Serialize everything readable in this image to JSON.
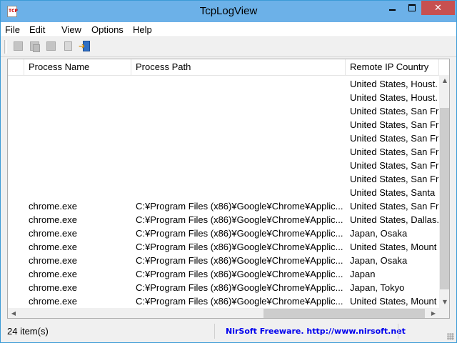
{
  "window": {
    "title": "TcpLogView"
  },
  "titlebar_buttons": {
    "close": "✕"
  },
  "menu": [
    "File",
    "Edit",
    "View",
    "Options",
    "Help"
  ],
  "toolbar": {
    "buttons": [
      "save-icon",
      "copy-icon",
      "properties-icon",
      "report-icon",
      "exit-icon"
    ]
  },
  "columns": [
    "Process Name",
    "Process Path",
    "Remote IP Country"
  ],
  "rows": [
    {
      "process_name": "",
      "process_path": "",
      "country": "United States, Houst."
    },
    {
      "process_name": "",
      "process_path": "",
      "country": "United States, Houst."
    },
    {
      "process_name": "",
      "process_path": "",
      "country": "United States, San Fr"
    },
    {
      "process_name": "",
      "process_path": "",
      "country": "United States, San Fr"
    },
    {
      "process_name": "",
      "process_path": "",
      "country": "United States, San Fr"
    },
    {
      "process_name": "",
      "process_path": "",
      "country": "United States, San Fr"
    },
    {
      "process_name": "",
      "process_path": "",
      "country": "United States, San Fr"
    },
    {
      "process_name": "",
      "process_path": "",
      "country": "United States, San Fr"
    },
    {
      "process_name": "",
      "process_path": "",
      "country": "United States, Santa"
    },
    {
      "process_name": "chrome.exe",
      "process_path": "C:¥Program Files (x86)¥Google¥Chrome¥Applic...",
      "country": "United States, San Fr"
    },
    {
      "process_name": "chrome.exe",
      "process_path": "C:¥Program Files (x86)¥Google¥Chrome¥Applic...",
      "country": "United States, Dallas."
    },
    {
      "process_name": "chrome.exe",
      "process_path": "C:¥Program Files (x86)¥Google¥Chrome¥Applic...",
      "country": "Japan, Osaka"
    },
    {
      "process_name": "chrome.exe",
      "process_path": "C:¥Program Files (x86)¥Google¥Chrome¥Applic...",
      "country": "United States, Mount"
    },
    {
      "process_name": "chrome.exe",
      "process_path": "C:¥Program Files (x86)¥Google¥Chrome¥Applic...",
      "country": "Japan, Osaka"
    },
    {
      "process_name": "chrome.exe",
      "process_path": "C:¥Program Files (x86)¥Google¥Chrome¥Applic...",
      "country": "Japan"
    },
    {
      "process_name": "chrome.exe",
      "process_path": "C:¥Program Files (x86)¥Google¥Chrome¥Applic...",
      "country": "Japan, Tokyo"
    },
    {
      "process_name": "chrome.exe",
      "process_path": "C:¥Program Files (x86)¥Google¥Chrome¥Applic...",
      "country": "United States, Mount"
    }
  ],
  "status": {
    "count": "24 item(s)",
    "link": "NirSoft Freeware.  http://www.nirsoft.net"
  },
  "colors": {
    "title_bar": "#6cb1e8",
    "close_button": "#c75050",
    "link": "#0000ee"
  }
}
